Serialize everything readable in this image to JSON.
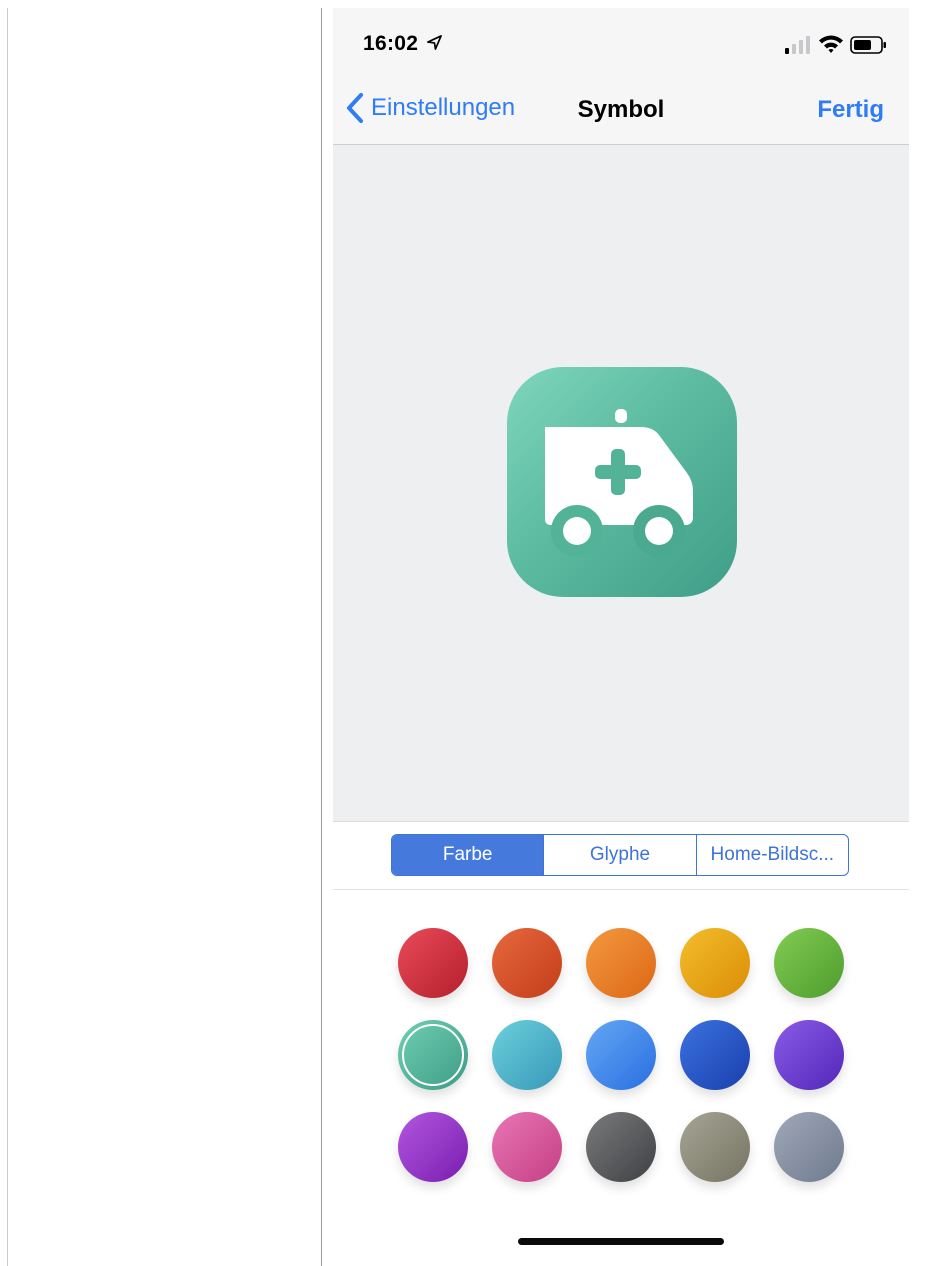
{
  "status_bar": {
    "time": "16:02",
    "icons": [
      "location-arrow-icon",
      "cellular-signal-icon",
      "wifi-icon",
      "battery-icon"
    ]
  },
  "nav": {
    "back_label": "Einstellungen",
    "title": "Symbol",
    "done_label": "Fertig"
  },
  "preview": {
    "icon": "ambulance-icon",
    "gradient": [
      "#7fd6bc",
      "#3f9e88"
    ]
  },
  "segments": [
    {
      "label": "Farbe",
      "active": true
    },
    {
      "label": "Glyphe",
      "active": false
    },
    {
      "label": "Home-Bildsc...",
      "active": false
    }
  ],
  "colors": [
    {
      "from": "#ea4a5a",
      "to": "#b41f2c",
      "selected": false
    },
    {
      "from": "#e6683e",
      "to": "#c43d1a",
      "selected": false
    },
    {
      "from": "#f3993f",
      "to": "#dd6715",
      "selected": false
    },
    {
      "from": "#f2be2c",
      "to": "#dc8d06",
      "selected": false
    },
    {
      "from": "#82cc52",
      "to": "#4f9c2e",
      "selected": false
    },
    {
      "from": "#6fcfb3",
      "to": "#3d9c84",
      "selected": true
    },
    {
      "from": "#6cd0dc",
      "to": "#3798b9",
      "selected": false
    },
    {
      "from": "#63a8f4",
      "to": "#2a6ee1",
      "selected": false
    },
    {
      "from": "#3a72e0",
      "to": "#1a3fac",
      "selected": false
    },
    {
      "from": "#8a5ce8",
      "to": "#5226b8",
      "selected": false
    },
    {
      "from": "#b257e0",
      "to": "#7a1db0",
      "selected": false
    },
    {
      "from": "#e876b6",
      "to": "#c53f84",
      "selected": false
    },
    {
      "from": "#7a7b7d",
      "to": "#3f4043",
      "selected": false
    },
    {
      "from": "#a6a596",
      "to": "#767361",
      "selected": false
    },
    {
      "from": "#a0a8b8",
      "to": "#6f7a8e",
      "selected": false
    }
  ],
  "accent": "#2f7cf6"
}
